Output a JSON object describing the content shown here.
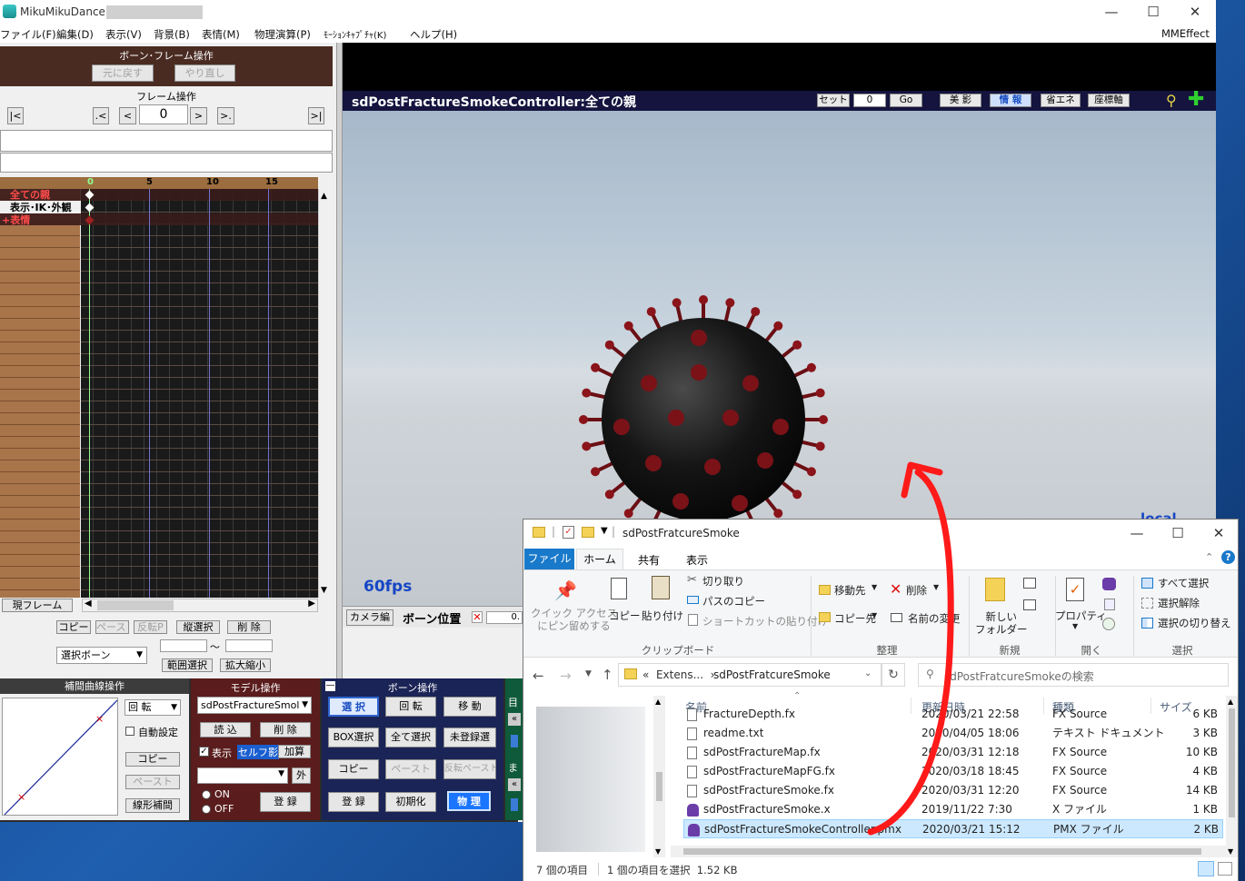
{
  "mmd": {
    "title": "MikuMikuDance [",
    "menu": [
      "ファイル(F)",
      "編集(D)",
      "表示(V)",
      "背景(B)",
      "表情(M)",
      "物理演算(P)",
      "ﾓｰｼｮﾝｷｬﾌﾟﾁｬ(K)",
      "ヘルプ(H)"
    ],
    "mmeffect": "MMEffect",
    "bone_frame": {
      "header": "ボーン･フレーム操作",
      "undo": "元に戻す",
      "redo": "やり直し"
    },
    "frame_op": {
      "header": "フレーム操作",
      "first": "|<",
      "prev_key": ".<",
      "prev": "<",
      "frame_value": "0",
      "next": ">",
      "next_key": ">.",
      "last": ">|"
    },
    "timeline": {
      "ticks": [
        "0",
        "5",
        "10",
        "15"
      ],
      "rows": [
        {
          "label": "全ての親",
          "color": "#ff4b4b"
        },
        {
          "label": "表示･IK･外観",
          "color": "#000000"
        },
        {
          "label": "+表情",
          "color": "#ff4b4b"
        }
      ],
      "current_frame_label": "現フレーム"
    },
    "frame_actions": {
      "copy": "コピー",
      "paste": "ペースト",
      "reverse_paste": "反転P",
      "vertical_select": "縦選択",
      "delete": "削 除",
      "select_bone": "選択ボーン",
      "tilde": "～",
      "range_select": "範囲選択",
      "scale": "拡大縮小"
    },
    "interp": {
      "header": "補間曲線操作",
      "rotate": "回 転",
      "auto": "自動設定",
      "copy": "コピー",
      "paste": "ペースト",
      "linear": "線形補間"
    },
    "model": {
      "header": "モデル操作",
      "model_name": "sdPostFractureSmol",
      "load": "読 込",
      "delete": "削 除",
      "show": "表示",
      "self_shadow": "セルフ影",
      "add": "加算",
      "outside": "外",
      "on": "ON",
      "off": "OFF",
      "register": "登 録"
    },
    "bone": {
      "header": "ボーン操作",
      "select": "選 択",
      "rotate": "回 転",
      "move": "移 動",
      "box_select": "BOX選択",
      "select_all": "全て選択",
      "unregistered": "未登録選",
      "copy": "コピー",
      "paste": "ペースト",
      "reverse_paste": "反転ペースト",
      "register": "登 録",
      "init": "初期化",
      "physics": "物 理"
    },
    "side_strip": [
      "目",
      "ま"
    ],
    "viewport": {
      "title": "sdPostFractureSmokeController:全ての親",
      "set_label": "セット",
      "set_value": "0",
      "go": "Go",
      "beauty_shadow": "美 影",
      "info": "情 報",
      "eco": "省エネ",
      "axis": "座標軸",
      "fps": "60fps",
      "local": "local",
      "camera_edit": "カメラ編",
      "bone_position": "ボーン位置",
      "pos_value": "0."
    }
  },
  "explorer": {
    "title": "sdPostFratcureSmoke",
    "tabs": [
      "ファイル",
      "ホーム",
      "共有",
      "表示"
    ],
    "ribbon": {
      "quick_access": "クイック アクセス\nにピン留めする",
      "copy": "コピー",
      "paste": "貼り付け",
      "cut": "切り取り",
      "copy_path": "パスのコピー",
      "paste_shortcut": "ショートカットの貼り付け",
      "clipboard": "クリップボード",
      "move_to": "移動先",
      "copy_to": "コピー先",
      "delete": "削除",
      "rename": "名前の変更",
      "organize": "整理",
      "new_folder": "新しい\nフォルダー",
      "new": "新規",
      "properties": "プロパティ",
      "open": "開く",
      "select_all": "すべて選択",
      "select_none": "選択解除",
      "invert_select": "選択の切り替え",
      "select": "選択"
    },
    "address": {
      "prefix": "«  Extens...  ›",
      "folder": "sdPostFratcureSmoke",
      "search_placeholder": "sdPostFratcureSmokeの検索"
    },
    "columns": [
      "名前",
      "更新日時",
      "種類",
      "サイズ"
    ],
    "files": [
      {
        "name": "FractureDepth.fx",
        "date": "2020/03/21 22:58",
        "type": "FX Source",
        "size": "6 KB",
        "icon": "doc"
      },
      {
        "name": "readme.txt",
        "date": "2020/04/05 18:06",
        "type": "テキスト ドキュメント",
        "size": "3 KB",
        "icon": "doc"
      },
      {
        "name": "sdPostFractureMap.fx",
        "date": "2020/03/31 12:18",
        "type": "FX Source",
        "size": "10 KB",
        "icon": "doc"
      },
      {
        "name": "sdPostFractureMapFG.fx",
        "date": "2020/03/18 18:45",
        "type": "FX Source",
        "size": "4 KB",
        "icon": "doc"
      },
      {
        "name": "sdPostFractureSmoke.fx",
        "date": "2020/03/31 12:20",
        "type": "FX Source",
        "size": "14 KB",
        "icon": "doc"
      },
      {
        "name": "sdPostFractureSmoke.x",
        "date": "2019/11/22 7:30",
        "type": "X ファイル",
        "size": "1 KB",
        "icon": "model"
      },
      {
        "name": "sdPostFractureSmokeController.pmx",
        "date": "2020/03/21 15:12",
        "type": "PMX ファイル",
        "size": "2 KB",
        "icon": "model"
      }
    ],
    "status": {
      "count": "7 個の項目",
      "selected": "1 個の項目を選択  1.52 KB"
    },
    "colors": {
      "accent": "#1979ca",
      "selected_row": "#cce8ff"
    }
  }
}
